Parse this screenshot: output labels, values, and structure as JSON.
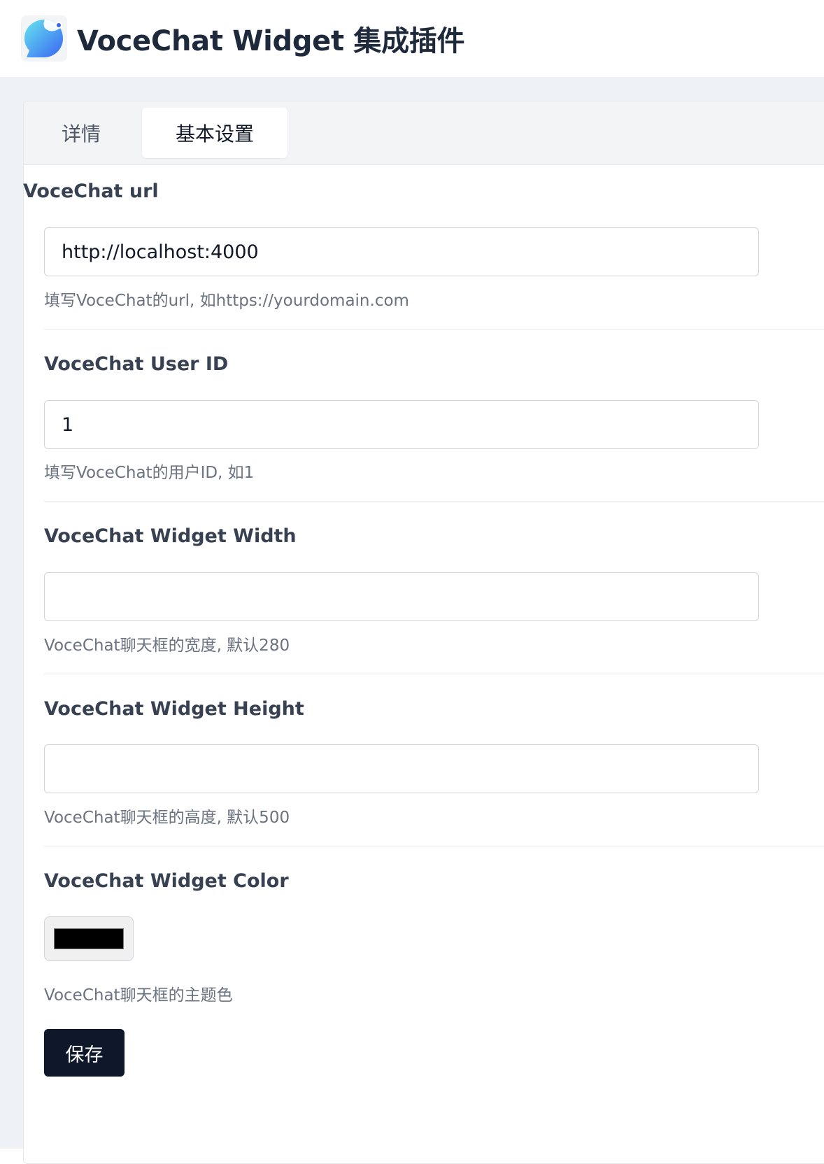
{
  "app": {
    "title": "VoceChat Widget 集成插件",
    "logo_icon": "vocechat-logo-icon"
  },
  "tabs": [
    {
      "label": "详情",
      "active": false
    },
    {
      "label": "基本设置",
      "active": true
    }
  ],
  "form": {
    "url": {
      "label": "VoceChat url",
      "value": "http://localhost:4000",
      "help": "填写VoceChat的url, 如https://yourdomain.com"
    },
    "user_id": {
      "label": "VoceChat User ID",
      "value": "1",
      "help": "填写VoceChat的用户ID, 如1"
    },
    "width": {
      "label": "VoceChat Widget Width",
      "value": "",
      "help": "VoceChat聊天框的宽度, 默认280"
    },
    "height": {
      "label": "VoceChat Widget Height",
      "value": "",
      "help": "VoceChat聊天框的高度, 默认500"
    },
    "color": {
      "label": "VoceChat Widget Color",
      "value": "#000000",
      "help": "VoceChat聊天框的主题色"
    }
  },
  "actions": {
    "save_label": "保存"
  },
  "colors": {
    "primary_button": "#0f172a",
    "page_background": "#eef2f7",
    "logo_gradient_start": "#5ee0f0",
    "logo_gradient_end": "#3b6cf6"
  }
}
